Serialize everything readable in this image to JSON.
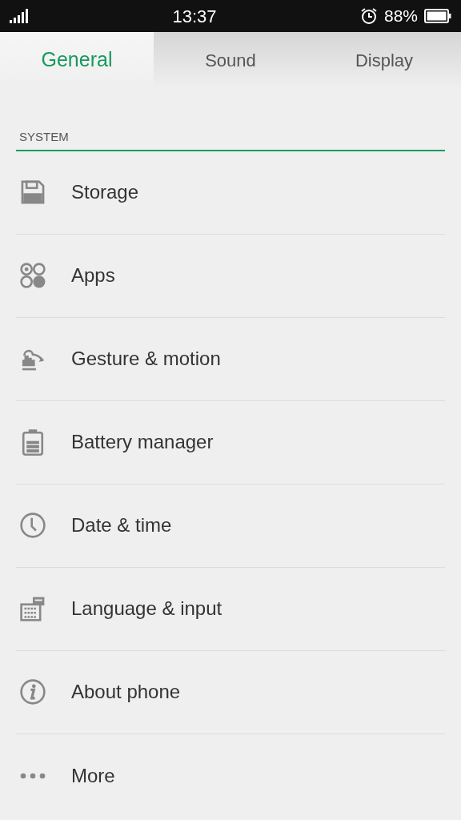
{
  "status_bar": {
    "time": "13:37",
    "battery": "88%",
    "alarm": true
  },
  "tabs": [
    {
      "label": "General",
      "selected": true
    },
    {
      "label": "Sound",
      "selected": false
    },
    {
      "label": "Display",
      "selected": false
    }
  ],
  "section": {
    "title": "SYSTEM"
  },
  "items": [
    {
      "label": "Storage",
      "kind": "storage"
    },
    {
      "label": "Apps",
      "kind": "apps"
    },
    {
      "label": "Gesture & motion",
      "kind": "gesture"
    },
    {
      "label": "Battery manager",
      "kind": "battery"
    },
    {
      "label": "Date & time",
      "kind": "clock"
    },
    {
      "label": "Language & input",
      "kind": "keyboard"
    },
    {
      "label": "About phone",
      "kind": "info"
    },
    {
      "label": "More",
      "kind": "more"
    }
  ]
}
